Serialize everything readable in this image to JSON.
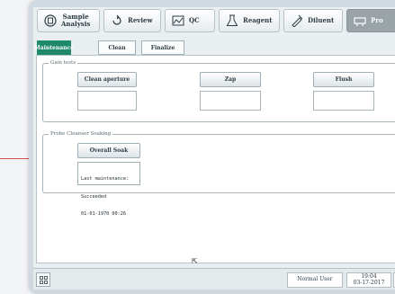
{
  "top_tabs": [
    {
      "label": "Sample\nAnalysis",
      "icon": "sample-analysis-icon"
    },
    {
      "label": "Review",
      "icon": "review-icon"
    },
    {
      "label": "QC",
      "icon": "qc-icon"
    },
    {
      "label": "Reagent",
      "icon": "reagent-icon"
    },
    {
      "label": "Diluent",
      "icon": "diluent-icon"
    },
    {
      "label": "Pro",
      "icon": "probe-icon"
    }
  ],
  "sub_tabs": [
    "Maintenance",
    "Clean",
    "Finalize"
  ],
  "gain_tests": {
    "title": "Gain tests",
    "buttons": [
      "Clean aperture",
      "Zap",
      "Flush"
    ]
  },
  "probe_cleanser": {
    "title": "Probe Cleanser Soaking",
    "button": "Overall Soak",
    "log_lines": [
      "Last maintenance:",
      "Succeeded",
      "01-01-1970 00:26"
    ]
  },
  "status_bar": {
    "user": "Normal User",
    "time": "19:04",
    "date": "03-17-2017"
  },
  "colors": {
    "active_subtab": "#1f8a6a",
    "active_toptab": "#9aa3a8",
    "accent_line": "#d24b4b"
  }
}
